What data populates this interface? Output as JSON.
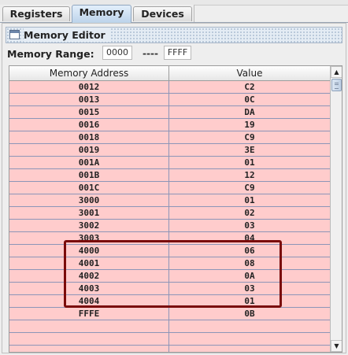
{
  "tabs": [
    {
      "label": "Registers",
      "selected": false
    },
    {
      "label": "Memory",
      "selected": true
    },
    {
      "label": "Devices",
      "selected": false
    }
  ],
  "editor": {
    "title": "Memory Editor",
    "range_label": "Memory Range:",
    "range_start": "0000",
    "range_separator": "----",
    "range_end": "FFFF"
  },
  "table": {
    "columns": [
      "Memory Address",
      "Value"
    ],
    "rows": [
      {
        "address": "0012",
        "value": "C2"
      },
      {
        "address": "0013",
        "value": "0C"
      },
      {
        "address": "0015",
        "value": "DA"
      },
      {
        "address": "0016",
        "value": "19"
      },
      {
        "address": "0018",
        "value": "C9"
      },
      {
        "address": "0019",
        "value": "3E"
      },
      {
        "address": "001A",
        "value": "01"
      },
      {
        "address": "001B",
        "value": "12"
      },
      {
        "address": "001C",
        "value": "C9"
      },
      {
        "address": "3000",
        "value": "01"
      },
      {
        "address": "3001",
        "value": "02"
      },
      {
        "address": "3002",
        "value": "03"
      },
      {
        "address": "3003",
        "value": "04"
      },
      {
        "address": "4000",
        "value": "06"
      },
      {
        "address": "4001",
        "value": "08"
      },
      {
        "address": "4002",
        "value": "0A"
      },
      {
        "address": "4003",
        "value": "03"
      },
      {
        "address": "4004",
        "value": "01"
      },
      {
        "address": "FFFE",
        "value": "0B"
      },
      {
        "address": "",
        "value": ""
      },
      {
        "address": "",
        "value": ""
      },
      {
        "address": "",
        "value": ""
      }
    ]
  },
  "highlight_rows": [
    "4000",
    "4001",
    "4002",
    "4003",
    "4004"
  ],
  "icons": {
    "window": "window-icon",
    "scroll_up": "arrow-up-icon",
    "scroll_down": "arrow-down-icon"
  },
  "colors": {
    "row_bg": "#ffcccc",
    "highlight_border": "#7a0b0b",
    "selected_tab": "#c4d8ec"
  }
}
